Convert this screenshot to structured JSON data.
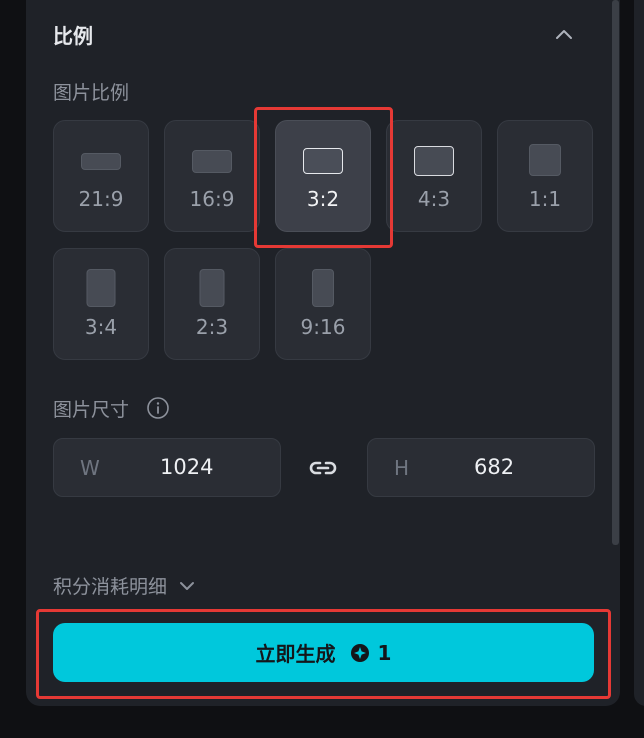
{
  "section": {
    "title": "比例",
    "collapse_icon": "chevron-up-icon"
  },
  "ratio": {
    "label": "图片比例",
    "selected": "3:2",
    "options": [
      {
        "label": "21:9"
      },
      {
        "label": "16:9"
      },
      {
        "label": "3:2"
      },
      {
        "label": "4:3"
      },
      {
        "label": "1:1"
      },
      {
        "label": "3:4"
      },
      {
        "label": "2:3"
      },
      {
        "label": "9:16"
      }
    ]
  },
  "size": {
    "label": "图片尺寸",
    "info_icon": "info-icon",
    "width_prefix": "W",
    "width_value": "1024",
    "height_prefix": "H",
    "height_value": "682",
    "link_icon": "link-icon"
  },
  "cost": {
    "label": "积分消耗明细",
    "expand_icon": "chevron-down-icon"
  },
  "generate": {
    "label": "立即生成",
    "credit_icon": "credit-icon",
    "credit_value": "1"
  },
  "colors": {
    "accent": "#00c8dc",
    "panel": "#1f2228",
    "highlight": "#e53935"
  }
}
